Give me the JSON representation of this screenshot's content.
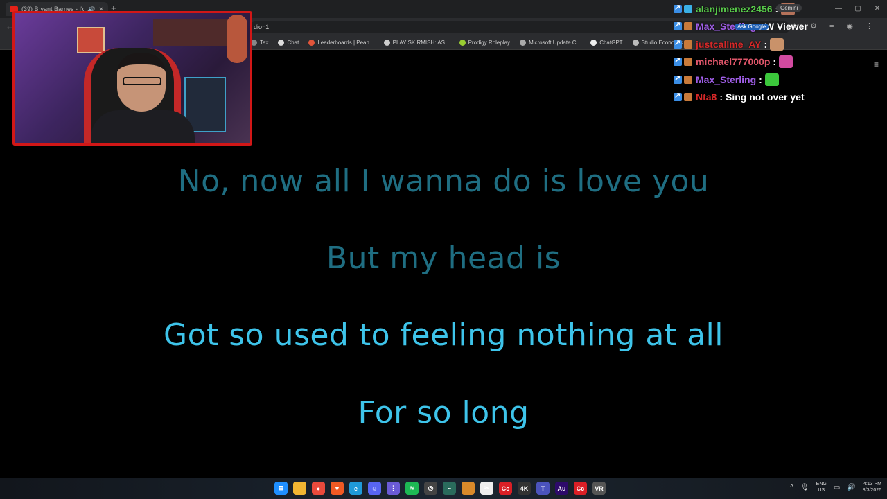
{
  "browser": {
    "tab_title": "(39) Bryant Barnes - I'd Rat...",
    "url_fragment": "dio=1",
    "gemini_label": "Gemini",
    "ask_google_label": "Ask Google",
    "bookmarks": [
      {
        "label": "Tax",
        "color": "#888888"
      },
      {
        "label": "Chat",
        "color": "#dddddd"
      },
      {
        "label": "Leaderboards | Pean...",
        "color": "#e2553a"
      },
      {
        "label": "PLAY SKIRMISH: AS...",
        "color": "#cccccc"
      },
      {
        "label": "Prodigy Roleplay",
        "color": "#9acd32"
      },
      {
        "label": "Microsoft Update C...",
        "color": "#aaaaaa"
      },
      {
        "label": "ChatGPT",
        "color": "#eeeeee"
      },
      {
        "label": "Studio Economik | C...",
        "color": "#bbbbbb"
      }
    ]
  },
  "chat": [
    {
      "name": "alanjimenez2456",
      "name_color": "#58c84a",
      "message": "",
      "emote_color": "#b5725a"
    },
    {
      "name": "Max_Sterling",
      "name_color": "#a05ee8",
      "message": "W Viewer",
      "emote_color": ""
    },
    {
      "name": "justcallme_AY",
      "name_color": "#d52828",
      "message": "",
      "emote_color": "#c9926a"
    },
    {
      "name": "michael777000p",
      "name_color": "#e0566a",
      "message": "",
      "emote_color": "#d24aa0"
    },
    {
      "name": "Max_Sterling",
      "name_color": "#a05ee8",
      "message": "",
      "emote_color": "#3cc83c"
    },
    {
      "name": "Nta8",
      "name_color": "#d52828",
      "message": "Sing not over yet",
      "emote_color": ""
    }
  ],
  "lyrics": [
    {
      "text": "No, now all I wanna do is love you",
      "state": "dim"
    },
    {
      "text": "But my head is",
      "state": "dim"
    },
    {
      "text": "Got so used to feeling nothing at all",
      "state": "bright"
    },
    {
      "text": "For so long",
      "state": "bright"
    }
  ],
  "taskbar": {
    "apps": [
      {
        "name": "start-icon",
        "color": "#1f8fff",
        "glyph": "⊞"
      },
      {
        "name": "file-explorer-icon",
        "color": "#f2b632",
        "glyph": ""
      },
      {
        "name": "chrome-icon",
        "color": "#e84a3c",
        "glyph": "●"
      },
      {
        "name": "brave-icon",
        "color": "#f05a24",
        "glyph": "▼"
      },
      {
        "name": "edge-icon",
        "color": "#1f9ad8",
        "glyph": "e"
      },
      {
        "name": "discord-icon",
        "color": "#5865f2",
        "glyph": "☺"
      },
      {
        "name": "apps-grid-icon",
        "color": "#6b5bd6",
        "glyph": "⋮"
      },
      {
        "name": "spotify-icon",
        "color": "#1db954",
        "glyph": "≋"
      },
      {
        "name": "obs-icon",
        "color": "#444444",
        "glyph": "◎"
      },
      {
        "name": "audio-app-icon",
        "color": "#2a6b5c",
        "glyph": "~"
      },
      {
        "name": "folder-icon",
        "color": "#d98a2a",
        "glyph": ""
      },
      {
        "name": "capcut-icon",
        "color": "#eeeeee",
        "glyph": "✂"
      },
      {
        "name": "creative-cloud-icon",
        "color": "#da1f26",
        "glyph": "Cc"
      },
      {
        "name": "4k-downloader-icon",
        "color": "#333333",
        "glyph": "4K"
      },
      {
        "name": "teams-icon",
        "color": "#4b53bc",
        "glyph": "T"
      },
      {
        "name": "audition-icon",
        "color": "#2d0a6a",
        "glyph": "Au"
      },
      {
        "name": "creative-cloud-alt-icon",
        "color": "#da1f26",
        "glyph": "Cc"
      },
      {
        "name": "vlc-icon",
        "color": "#555555",
        "glyph": "VR"
      }
    ],
    "language_top": "ENG",
    "language_bottom": "US",
    "time": "4:13 PM",
    "date": "8/3/2026"
  }
}
